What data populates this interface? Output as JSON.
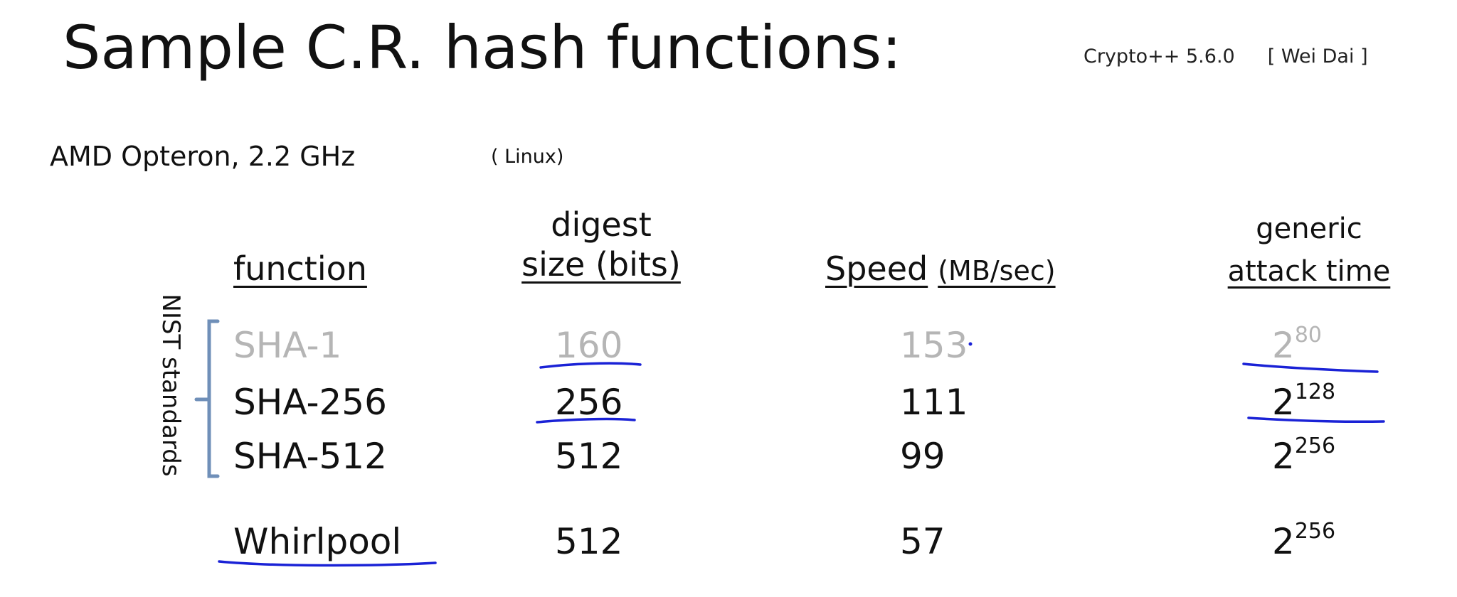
{
  "title": "Sample C.R. hash functions:",
  "credit": {
    "library": "Crypto++  5.6.0",
    "author": "[ Wei Dai ]"
  },
  "platform": "AMD Opteron,   2.2 GHz",
  "os": "( Linux)",
  "side_label": "NIST standards",
  "headers": {
    "function": "function",
    "digest_top": "digest",
    "digest_bottom": "size (bits)",
    "speed": "Speed",
    "speed_unit": "(MB/sec)",
    "attack_top": "generic",
    "attack_bottom": "attack time"
  },
  "rows": [
    {
      "function": "SHA-1",
      "digest": "160",
      "speed": "153",
      "attack_base": "2",
      "attack_exp": "80"
    },
    {
      "function": "SHA-256",
      "digest": "256",
      "speed": "111",
      "attack_base": "2",
      "attack_exp": "128"
    },
    {
      "function": "SHA-512",
      "digest": "512",
      "speed": "99",
      "attack_base": "2",
      "attack_exp": "256"
    },
    {
      "function": "Whirlpool",
      "digest": "512",
      "speed": "57",
      "attack_base": "2",
      "attack_exp": "256"
    }
  ],
  "colors": {
    "text": "#111111",
    "muted": "#b5b5b5",
    "bracket": "#6f8fb8",
    "ink": "#1a22d6"
  }
}
